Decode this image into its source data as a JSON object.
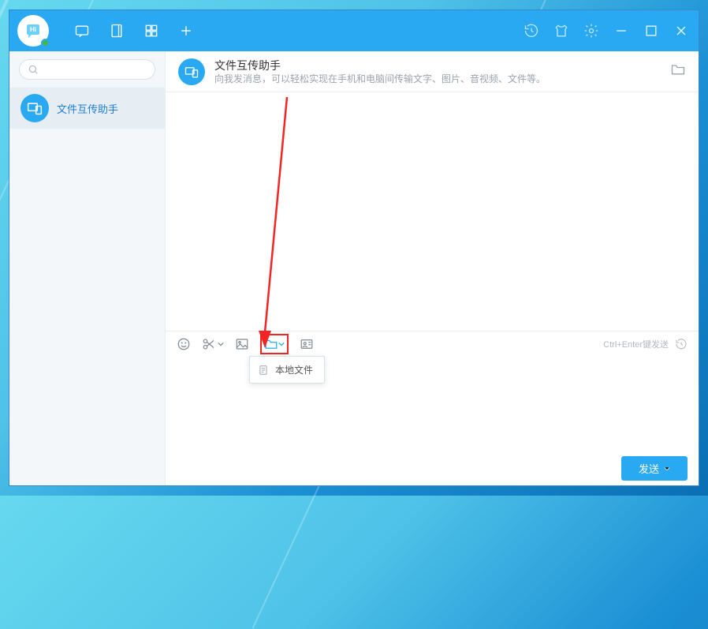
{
  "titlebar": {
    "logo_badge": "Hi"
  },
  "sidebar": {
    "search_placeholder": "",
    "contact_name": "文件互传助手"
  },
  "chat": {
    "title": "文件互传助手",
    "subtitle": "向我发消息，可以轻松实现在手机和电脑间传输文字、图片、音视频、文件等。"
  },
  "toolbar": {
    "send_hint": "Ctrl+Enter键发送"
  },
  "dropdown": {
    "local_file": "本地文件"
  },
  "footer": {
    "send_label": "发送"
  }
}
